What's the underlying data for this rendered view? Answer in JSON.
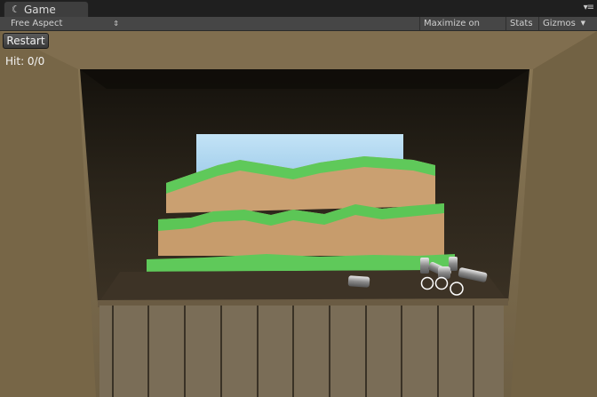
{
  "tab": {
    "label": "Game",
    "icon": "unity-logo-icon"
  },
  "toolbar": {
    "aspect": "Free Aspect",
    "maximize": "Maximize on Play",
    "stats": "Stats",
    "gizmos": "Gizmos"
  },
  "hud": {
    "restart_label": "Restart",
    "hit_text": "Hit: 0/0"
  },
  "colors": {
    "wall": "#7a6a4c",
    "shadow": "#1c1812",
    "sky": "#a8d2ee",
    "grass": "#5fc95a",
    "dirt": "#caa071",
    "crate": "#7a6d57"
  }
}
